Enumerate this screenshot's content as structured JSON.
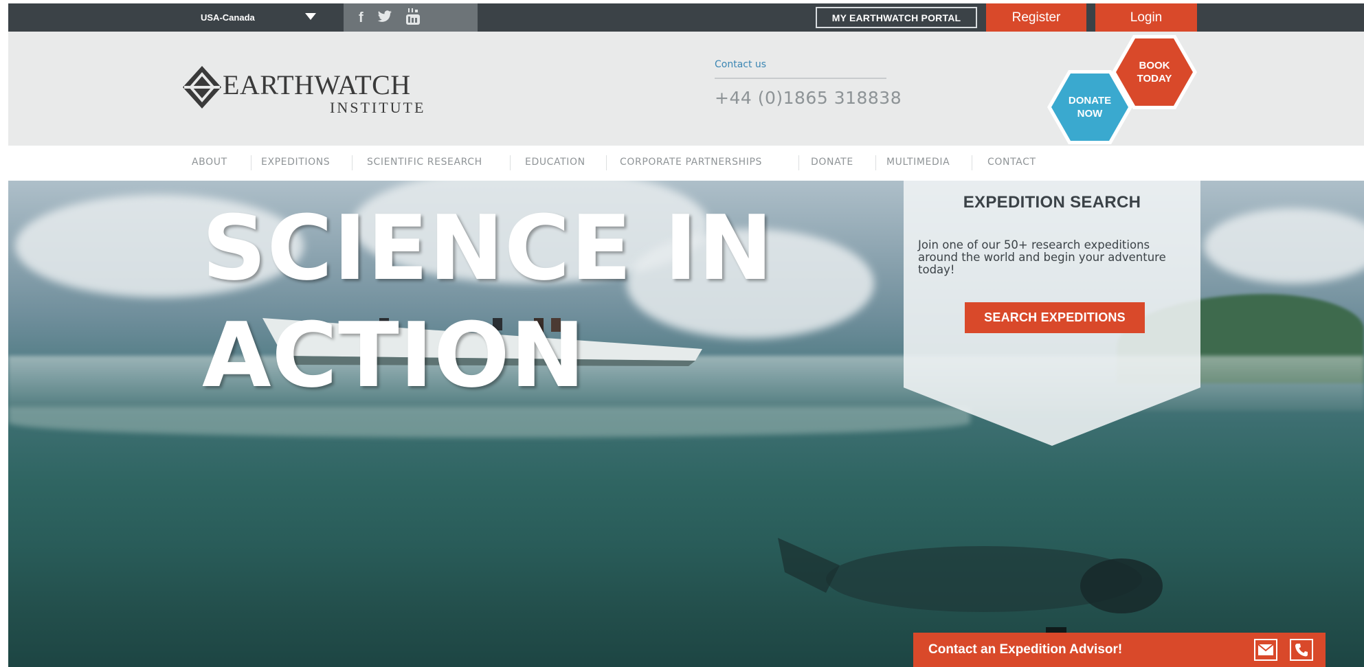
{
  "topbar": {
    "region_label": "USA-Canada",
    "social": [
      {
        "icon": "facebook-icon",
        "glyph": "f"
      },
      {
        "icon": "twitter-icon",
        "glyph": "🐦"
      },
      {
        "icon": "youtube-icon",
        "glyph": "You"
      }
    ],
    "portal_label": "MY EARTHWATCH PORTAL",
    "register_label": "Register",
    "login_label": "Login"
  },
  "header": {
    "logo_text": "EARTHWATCH",
    "logo_sub": "INSTITUTE",
    "contact_label": "Contact us",
    "contact_phone": "+44 (0)1865 318838",
    "book_line1": "BOOK",
    "book_line2": "TODAY",
    "donate_line1": "DONATE",
    "donate_line2": "NOW"
  },
  "nav": {
    "items": [
      "ABOUT",
      "EXPEDITIONS",
      "SCIENTIFIC RESEARCH",
      "EDUCATION",
      "CORPORATE PARTNERSHIPS",
      "DONATE",
      "MULTIMEDIA",
      "CONTACT"
    ]
  },
  "hero": {
    "title_line1": "SCIENCE IN",
    "title_line2": "ACTION"
  },
  "search": {
    "title": "EXPEDITION SEARCH",
    "description": "Join one of our 50+ research expeditions around the world and begin your adventure today!",
    "button_label": "SEARCH EXPEDITIONS"
  },
  "advisor": {
    "label": "Contact an Expedition Advisor!"
  },
  "colors": {
    "accent": "#d9492a",
    "donate": "#3aa9cf",
    "topbar": "#3b4247"
  }
}
